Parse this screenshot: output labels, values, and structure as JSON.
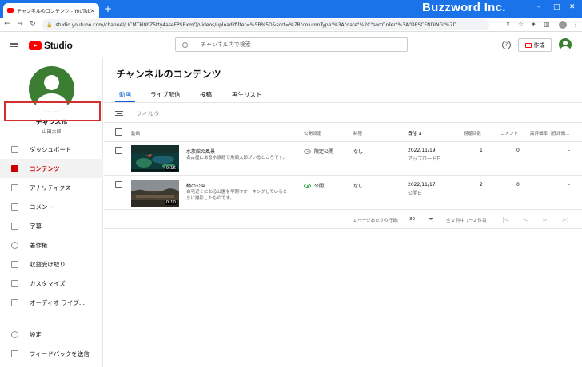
{
  "browser": {
    "tab_title": "チャンネルのコンテンツ - YouTube Stu",
    "url": "studio.youtube.com/channel/UCMTkl0hZ5tty4aseFPSRxmQ/videos/upload?filter=%5B%5D&sort=%7B\"columnType\"%3A\"date\"%2C\"sortOrder\"%3A\"DESCENDING\"%7D",
    "watermark": "Buzzword Inc."
  },
  "header": {
    "logo_text": "Studio",
    "search_placeholder": "チャンネル内で検索",
    "create_label": "作成",
    "help_label": "?"
  },
  "sidebar": {
    "channel_title": "チャンネル",
    "channel_name": "山田太郎",
    "items": [
      {
        "label": "ダッシュボード",
        "icon": "dashboard-icon"
      },
      {
        "label": "コンテンツ",
        "icon": "content-icon"
      },
      {
        "label": "アナリティクス",
        "icon": "analytics-icon"
      },
      {
        "label": "コメント",
        "icon": "comment-icon"
      },
      {
        "label": "字幕",
        "icon": "subtitles-icon"
      },
      {
        "label": "著作権",
        "icon": "copyright-icon"
      },
      {
        "label": "収益受け取り",
        "icon": "monetization-icon"
      },
      {
        "label": "カスタマイズ",
        "icon": "customize-icon"
      },
      {
        "label": "オーディオ ライブ...",
        "icon": "audio-library-icon"
      },
      {
        "label": "設定",
        "icon": "settings-icon"
      },
      {
        "label": "フィードバックを送信",
        "icon": "feedback-icon"
      }
    ]
  },
  "main": {
    "page_title": "チャンネルのコンテンツ",
    "tabs": [
      {
        "label": "動画"
      },
      {
        "label": "ライブ配信"
      },
      {
        "label": "投稿"
      },
      {
        "label": "再生リスト"
      }
    ],
    "filter_label": "フィルタ",
    "columns": {
      "video": "動画",
      "visibility": "公開設定",
      "restrictions": "制限",
      "date": "日付 ↓",
      "views": "視聴回数",
      "comments": "コメント",
      "likes": "高評価率（低評価..."
    },
    "rows": [
      {
        "title": "水族館の風景",
        "description": "名古屋にある水族館で魚類太郎がいるところです。",
        "duration": "0:16",
        "visibility": "限定公開",
        "restriction": "なし",
        "date": "2022/11/19",
        "date_status": "アップロード日",
        "views": "1",
        "comments": "0",
        "likes": "–"
      },
      {
        "title": "鶴の公園",
        "description": "自宅近くにある公園を早朝ウオーキングしているときに撮影したものです。",
        "duration": "0:10",
        "visibility": "公開",
        "restriction": "なし",
        "date": "2022/11/17",
        "date_status": "公開日",
        "views": "2",
        "comments": "0",
        "likes": "–"
      }
    ],
    "pagination": {
      "rows_per_page_label": "1 ページあたりの行数:",
      "rows_per_page": "30",
      "range": "全 2 件中 1～2 件目"
    }
  }
}
